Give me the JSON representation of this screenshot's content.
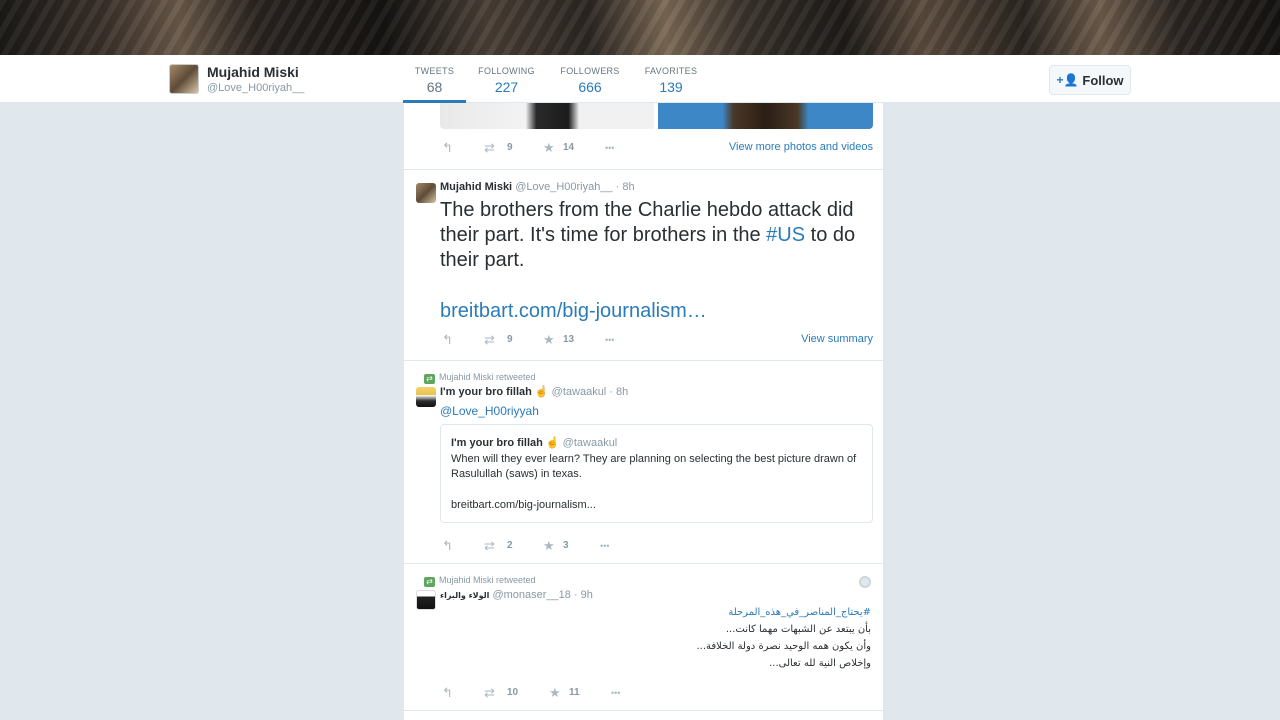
{
  "profile": {
    "name": "Mujahid Miski",
    "handle": "@Love_H00riyah__"
  },
  "stats": [
    {
      "label": "TWEETS",
      "value": "68"
    },
    {
      "label": "FOLLOWING",
      "value": "227"
    },
    {
      "label": "FOLLOWERS",
      "value": "666"
    },
    {
      "label": "FAVORITES",
      "value": "139"
    }
  ],
  "follow_button": {
    "label": "Follow"
  },
  "tweets": [
    {
      "retweets": "9",
      "favorites": "14",
      "more_link": "View more photos and videos"
    },
    {
      "name": "Mujahid Miski",
      "handle_time": "@Love_H00riyah__ · 8h",
      "text_before": "The brothers from the Charlie hebdo attack did their part. It's time for brothers in the ",
      "hashtag": "#US",
      "text_after": " to do their part.",
      "link": "breitbart.com/big-journalism…",
      "retweets": "9",
      "favorites": "13",
      "more_link": "View summary"
    },
    {
      "retweeted_by": "Mujahid Miski retweeted",
      "name": "I'm your bro fillah ☝",
      "handle_time": "@tawaakul · 8h",
      "reply_to": "@Love_H00riyyah",
      "quote": {
        "name": "I'm your bro fillah ☝",
        "handle": "@tawaakul",
        "text": "When will they ever learn? They are planning on selecting the best picture drawn of Rasulullah (saws) in texas.",
        "link": "breitbart.com/big-journalism..."
      },
      "retweets": "2",
      "favorites": "3"
    },
    {
      "retweeted_by": "Mujahid Miski retweeted",
      "name": "الولاء والبراء",
      "handle_time": "@monaser__18 · 9h",
      "hashtag": "#يحتاج_المناصر_في_هذه_المرحلة",
      "line1": "بأن يبتعد عن الشبهات مهما كانت...",
      "line2": "وأن يكون همه الوحيد نصرة دولة الخلافة...",
      "line3": "وإخلاص النية لله تعالى...",
      "retweets": "10",
      "favorites": "11"
    }
  ],
  "icons": {
    "reply": "↰",
    "retweet": "⇄",
    "favorite": "★",
    "more": "•••"
  }
}
